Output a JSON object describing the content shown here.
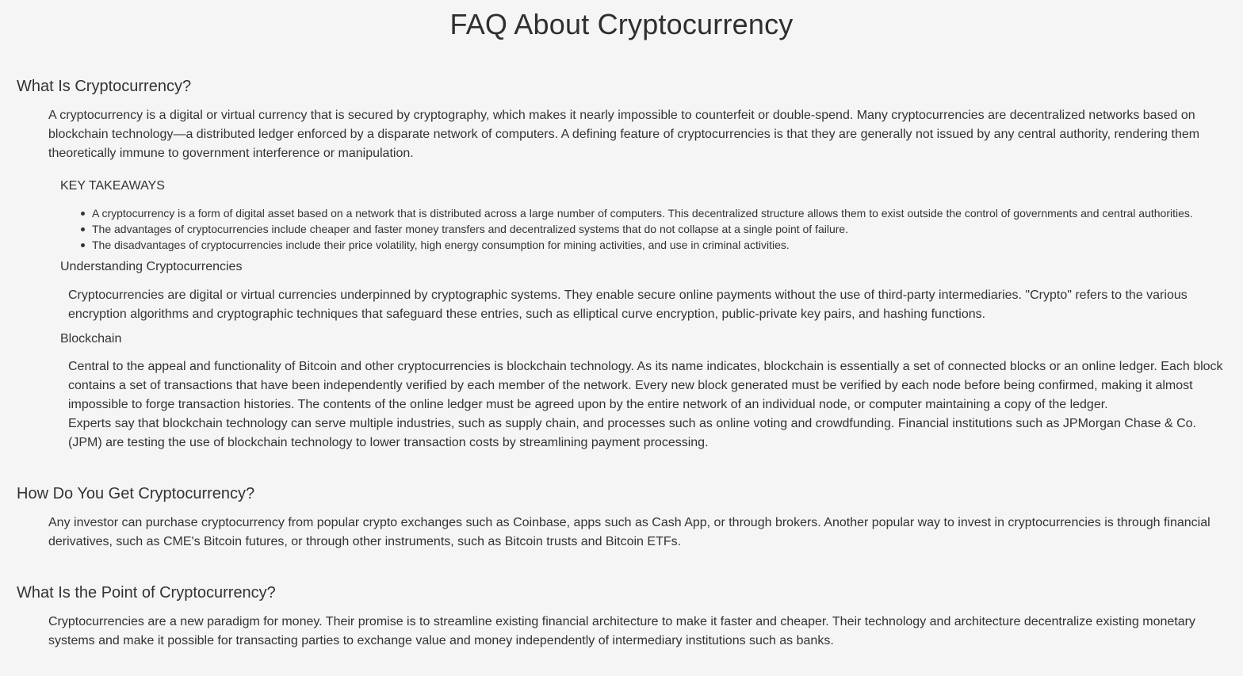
{
  "page": {
    "title": "FAQ About Cryptocurrency"
  },
  "faq": [
    {
      "question": "What Is Cryptocurrency?",
      "answer": "A cryptocurrency is a digital or virtual currency that is secured by cryptography, which makes it nearly impossible to counterfeit or double-spend. Many cryptocurrencies are decentralized networks based on blockchain technology—a distributed ledger enforced by a disparate network of computers. A defining feature of cryptocurrencies is that they are generally not issued by any central authority, rendering them theoretically immune to government interference or manipulation.",
      "key_takeaways": {
        "heading": "KEY TAKEAWAYS",
        "items": [
          "A cryptocurrency is a form of digital asset based on a network that is distributed across a large number of computers. This decentralized structure allows them to exist outside the control of governments and central authorities.",
          "The advantages of cryptocurrencies include cheaper and faster money transfers and decentralized systems that do not collapse at a single point of failure.",
          "The disadvantages of cryptocurrencies include their price volatility, high energy consumption for mining activities, and use in criminal activities."
        ]
      },
      "understanding": {
        "heading": "Understanding Cryptocurrencies",
        "text": "Cryptocurrencies are digital or virtual currencies underpinned by cryptographic systems. They enable secure online payments without the use of third-party intermediaries. \"Crypto\" refers to the various encryption algorithms and cryptographic techniques that safeguard these entries, such as elliptical curve encryption, public-private key pairs, and hashing functions."
      },
      "blockchain": {
        "heading": "Blockchain",
        "paragraph_1": "Central to the appeal and functionality of Bitcoin and other cryptocurrencies is blockchain technology. As its name indicates, blockchain is essentially a set of connected blocks or an online ledger. Each block contains a set of transactions that have been independently verified by each member of the network. Every new block generated must be verified by each node before being confirmed, making it almost impossible to forge transaction histories. The contents of the online ledger must be agreed upon by the entire network of an individual node, or computer maintaining a copy of the ledger.",
        "paragraph_2": "Experts say that blockchain technology can serve multiple industries, such as supply chain, and processes such as online voting and crowdfunding. Financial institutions such as JPMorgan Chase & Co. (JPM) are testing the use of blockchain technology to lower transaction costs by streamlining payment processing."
      }
    },
    {
      "question": "How Do You Get Cryptocurrency?",
      "answer": "Any investor can purchase cryptocurrency from popular crypto exchanges such as Coinbase, apps such as Cash App, or through brokers. Another popular way to invest in cryptocurrencies is through financial derivatives, such as CME's Bitcoin futures, or through other instruments, such as Bitcoin trusts and Bitcoin ETFs."
    },
    {
      "question": "What Is the Point of Cryptocurrency?",
      "answer": "Cryptocurrencies are a new paradigm for money. Their promise is to streamline existing financial architecture to make it faster and cheaper. Their technology and architecture decentralize existing monetary systems and make it possible for transacting parties to exchange value and money independently of intermediary institutions such as banks."
    }
  ]
}
